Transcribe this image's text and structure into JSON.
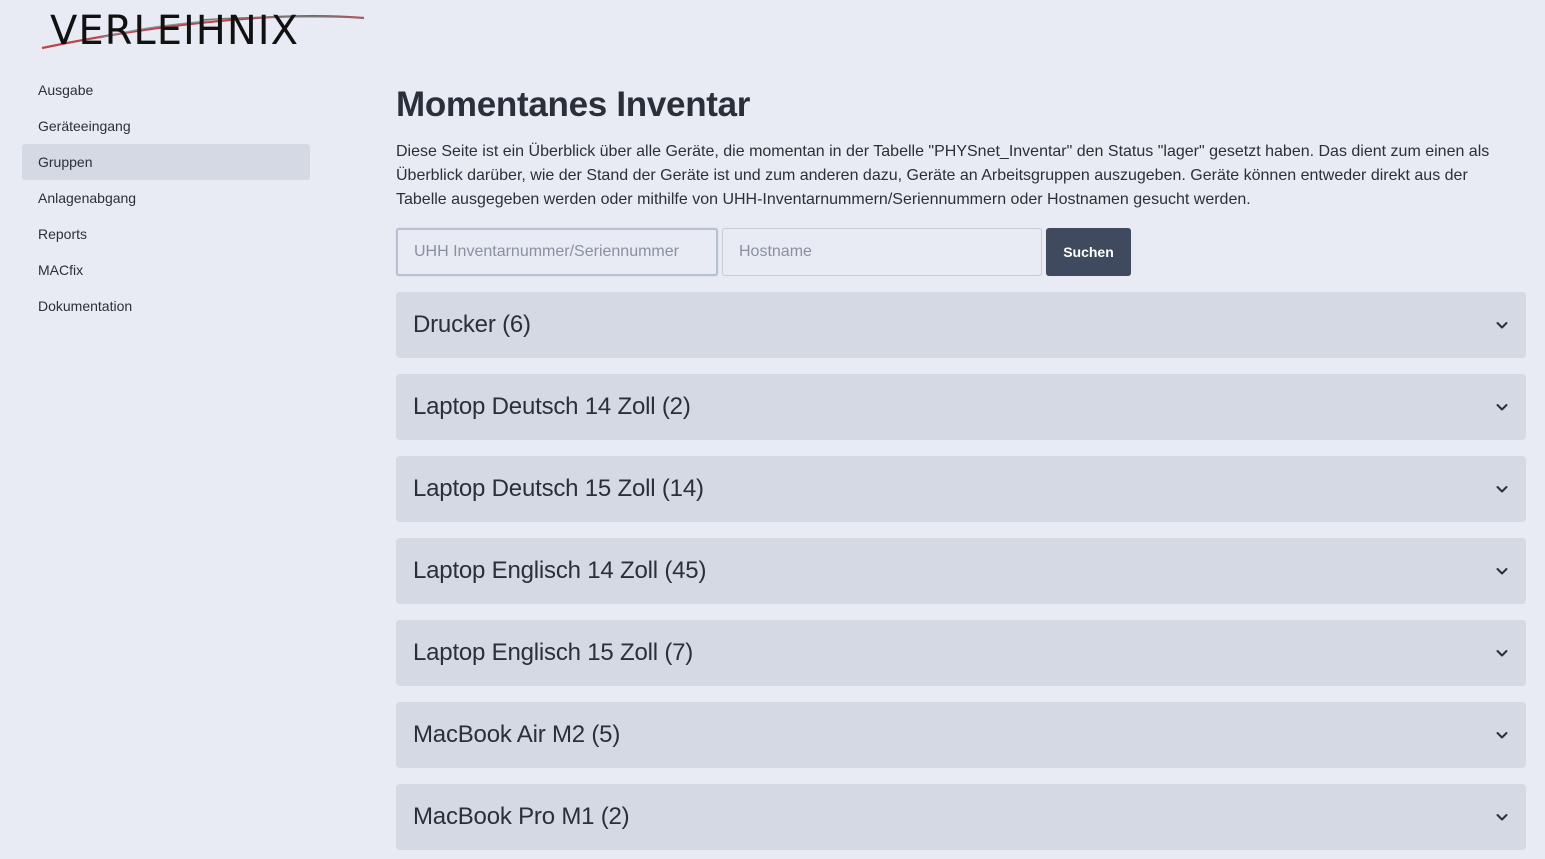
{
  "logo": {
    "text": "VERLEIHNIX"
  },
  "sidebar": {
    "items": [
      {
        "label": "Ausgabe",
        "active": false
      },
      {
        "label": "Geräteeingang",
        "active": false
      },
      {
        "label": "Gruppen",
        "active": true
      },
      {
        "label": "Anlagenabgang",
        "active": false
      },
      {
        "label": "Reports",
        "active": false
      },
      {
        "label": "MACfix",
        "active": false
      },
      {
        "label": "Dokumentation",
        "active": false
      }
    ]
  },
  "main": {
    "title": "Momentanes Inventar",
    "intro": "Diese Seite ist ein Überblick über alle Geräte, die momentan in der Tabelle \"PHYSnet_Inventar\" den Status \"lager\" gesetzt haben. Das dient zum einen als Überblick darüber, wie der Stand der Geräte ist und zum anderen dazu, Geräte an Arbeitsgruppen auszugeben. Geräte können entweder direkt aus der Tabelle ausgegeben werden oder mithilfe von UHH-Inventarnummern/Seriennummern oder Hostnamen gesucht werden.",
    "search": {
      "inventory_placeholder": "UHH Inventarnummer/Seriennummer",
      "inventory_value": "",
      "hostname_placeholder": "Hostname",
      "hostname_value": "",
      "button_label": "Suchen"
    },
    "groups": [
      {
        "label": "Drucker (6)"
      },
      {
        "label": "Laptop Deutsch 14 Zoll (2)"
      },
      {
        "label": "Laptop Deutsch 15 Zoll (14)"
      },
      {
        "label": "Laptop Englisch 14 Zoll (45)"
      },
      {
        "label": "Laptop Englisch 15 Zoll (7)"
      },
      {
        "label": "MacBook Air M2 (5)"
      },
      {
        "label": "MacBook Pro M1 (2)"
      }
    ]
  },
  "colors": {
    "background": "#e8ebf3",
    "sidebar_active": "#d5d9e3",
    "accordion": "#d4d9e4",
    "button": "#3f4a5e",
    "logo_swoosh": "#b8474d"
  },
  "icons": {
    "accordion": "chevron-down-icon"
  }
}
